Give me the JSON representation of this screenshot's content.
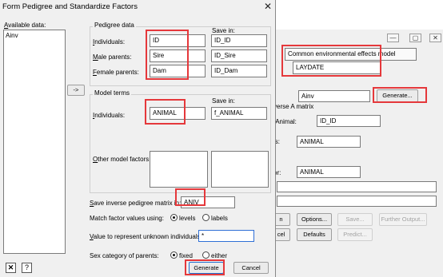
{
  "dialog": {
    "title": "Form Pedigree and Standardize Factors",
    "available_data_label": "Available data:",
    "available_items": [
      "Ainv"
    ],
    "move_button": "->",
    "pedigree_group": {
      "title": "Pedigree data",
      "save_in_header": "Save in:",
      "rows": [
        {
          "label": "Individuals:",
          "value": "ID",
          "save": "ID_ID"
        },
        {
          "label": "Male parents:",
          "value": "Sire",
          "save": "ID_Sire"
        },
        {
          "label": "Female parents:",
          "value": "Dam",
          "save": "ID_Dam"
        }
      ]
    },
    "model_terms_group": {
      "title": "Model terms",
      "save_in_header": "Save in:",
      "individuals_label": "Individuals:",
      "individuals_value": "ANIMAL",
      "individuals_save": "f_ANIMAL",
      "other_factors_label": "Other model factors:"
    },
    "save_inverse_label": "Save inverse pedigree matrix in:",
    "save_inverse_value": "ANIV",
    "match_label": "Match factor values using:",
    "match_options": [
      "levels",
      "labels"
    ],
    "match_selected": "levels",
    "unknown_label": "Value to represent unknown individuals:",
    "unknown_value": "*",
    "sex_label": "Sex category of parents:",
    "sex_options": [
      "fixed",
      "either"
    ],
    "sex_selected": "fixed",
    "buttons": {
      "generate": "Generate",
      "cancel": "Cancel"
    },
    "icons": [
      "close-icon",
      "help-icon"
    ]
  },
  "back_window": {
    "model_select": "Common environmental effects model",
    "laydate_value": "LAYDATE",
    "ainv_value": "Ainv",
    "generate_button": "Generate...",
    "inverse_label": "verse A matrix",
    "animal_label": "/Animal:",
    "animal_value": "ID_ID",
    "ls_label": "ls:",
    "ls_value": "ANIMAL",
    "or_label": "or:",
    "or_value": "ANIMAL",
    "buttons_row1": [
      "n",
      "Options...",
      "Save...",
      "Further Output..."
    ],
    "buttons_row2": [
      "cel",
      "Defaults",
      "Predict..."
    ]
  },
  "highlight_color": "#e5383b"
}
